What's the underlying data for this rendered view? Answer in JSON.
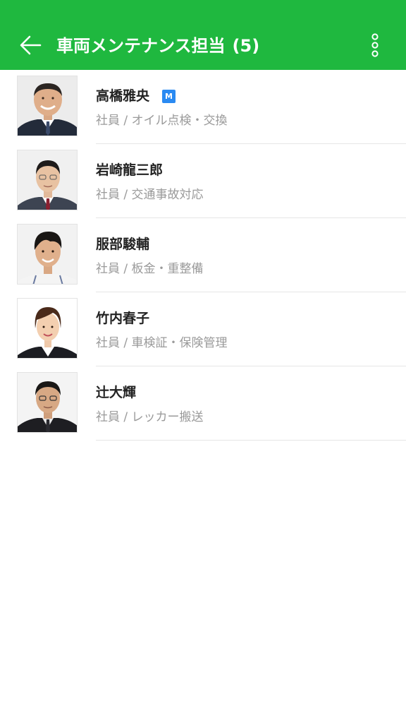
{
  "header": {
    "title": "車両メンテナンス担当",
    "count": "(5)",
    "back_icon": "arrow-left-icon",
    "menu_icon": "more-vertical-icon",
    "background_color": "#1fb83f"
  },
  "members": [
    {
      "name": "高橋雅央",
      "badge": "M",
      "role": "社員 / オイル点検・交換"
    },
    {
      "name": "岩崎龍三郎",
      "role": "社員 / 交通事故対応"
    },
    {
      "name": "服部駿輔",
      "role": "社員 / 板金・重整備"
    },
    {
      "name": "竹内春子",
      "role": "社員 / 車検証・保険管理"
    },
    {
      "name": "辻大輝",
      "role": "社員 / レッカー搬送"
    }
  ],
  "colors": {
    "badge": "#2a8af2",
    "name_text": "#222222",
    "role_text": "#9a9a9a"
  }
}
